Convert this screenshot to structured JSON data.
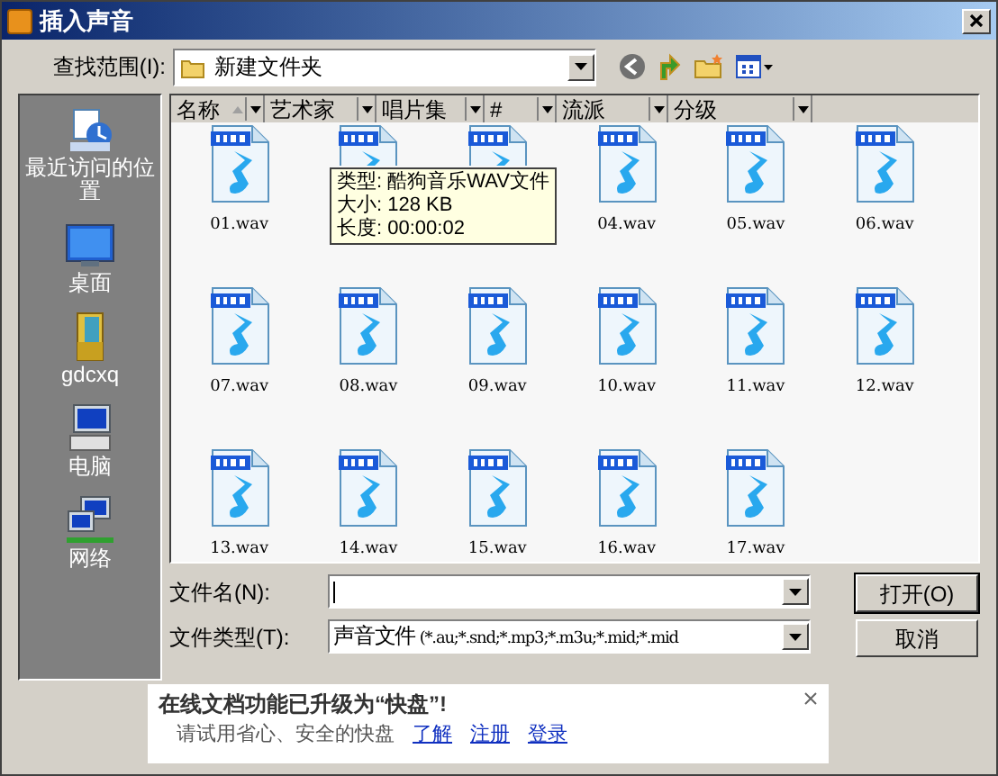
{
  "window": {
    "title": "插入声音"
  },
  "look_in": {
    "label": "查找范围(I):",
    "value": "新建文件夹"
  },
  "sidebar": {
    "items": [
      {
        "label": "最近访问的位置",
        "kind": "recent"
      },
      {
        "label": "桌面",
        "kind": "desktop"
      },
      {
        "label": "gdcxq",
        "kind": "folder"
      },
      {
        "label": "电脑",
        "kind": "computer"
      },
      {
        "label": "网络",
        "kind": "network"
      }
    ]
  },
  "columns": [
    {
      "label": "名称",
      "sorted": true
    },
    {
      "label": "艺术家",
      "sorted": false
    },
    {
      "label": "唱片集",
      "sorted": false
    },
    {
      "label": "#",
      "sorted": false
    },
    {
      "label": "流派",
      "sorted": false
    },
    {
      "label": "分级",
      "sorted": false
    }
  ],
  "files": [
    {
      "kind": "file",
      "name": "01.wav"
    },
    {
      "kind": "covered"
    },
    {
      "kind": "covered"
    },
    {
      "name": "04.wav"
    },
    {
      "name": "05.wav"
    },
    {
      "name": "06.wav"
    },
    {
      "name": "07.wav"
    },
    {
      "name": "08.wav"
    },
    {
      "name": "09.wav"
    },
    {
      "name": "10.wav"
    },
    {
      "name": "11.wav"
    },
    {
      "name": "12.wav"
    },
    {
      "name": "13.wav"
    },
    {
      "name": "14.wav"
    },
    {
      "name": "15.wav"
    },
    {
      "name": "16.wav"
    },
    {
      "name": "17.wav"
    }
  ],
  "tooltip": {
    "lines": [
      "类型: 酷狗音乐WAV文件",
      "大小: 128 KB",
      "长度: 00:00:02"
    ]
  },
  "file_name": {
    "label": "文件名(N):"
  },
  "file_type": {
    "label": "文件类型(T):",
    "value": "声音文件 (*.au;*.snd;*.mp3;*.m3u;*.mid;*.mid"
  },
  "buttons": [
    "打开(O)",
    "取消"
  ],
  "banner": {
    "title": "在线文档功能已升级为“快盘”!",
    "text": "请试用省心、安全的快盘",
    "links": [
      "了解",
      "注册",
      "登录"
    ]
  }
}
